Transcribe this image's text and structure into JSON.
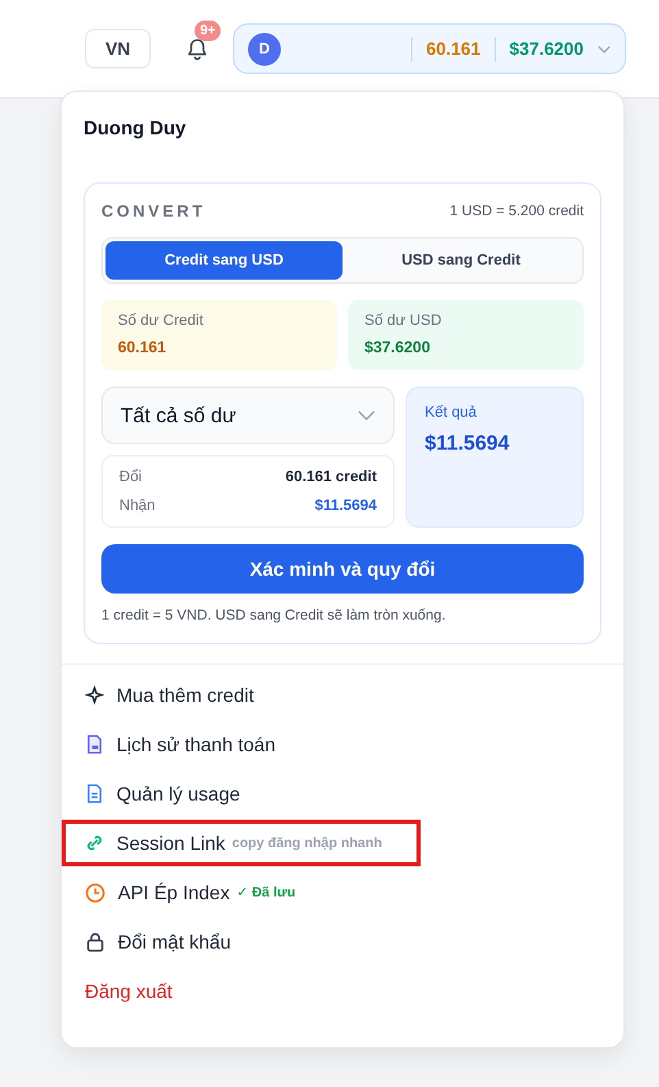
{
  "header": {
    "language": "VN",
    "notifications_badge": "9+",
    "account": {
      "avatar": "D",
      "credit": "60.161",
      "usd": "$37.6200"
    }
  },
  "profile": {
    "name": "Duong Duy"
  },
  "convert": {
    "title": "CONVERT",
    "rate": "1 USD = 5.200 credit",
    "modes": [
      {
        "label": "Credit sang USD",
        "selected": true
      },
      {
        "label": "USD sang Credit",
        "selected": false
      }
    ],
    "balances": [
      {
        "label": "Số dư Credit",
        "value": "60.161",
        "kind": "credit"
      },
      {
        "label": "Số dư USD",
        "value": "$37.6200",
        "kind": "usd"
      }
    ],
    "amount_select": "Tất cả số dư",
    "summary": [
      {
        "label": "Đổi",
        "value": "60.161 credit",
        "kind": "plain"
      },
      {
        "label": "Nhận",
        "value": "$11.5694",
        "kind": "accent"
      }
    ],
    "result": {
      "label": "Kết quả",
      "value": "$11.5694"
    },
    "submit": "Xác minh và quy đổi",
    "footnote": "1 credit = 5 VND. USD sang Credit sẽ làm tròn xuống."
  },
  "menu": [
    {
      "label": "Mua thêm credit",
      "kind": "sparkle",
      "highlighted": false
    },
    {
      "label": "Lịch sử thanh toán",
      "kind": "receipt",
      "highlighted": false
    },
    {
      "label": "Quản lý usage",
      "kind": "document",
      "highlighted": false
    },
    {
      "label": "Session Link",
      "kind": "link",
      "note": {
        "text": "copy đăng nhập nhanh",
        "kind": "hint"
      },
      "highlighted": true
    },
    {
      "label": "API Ép Index",
      "kind": "clock",
      "note": {
        "text": "✓ Đã lưu",
        "kind": "saved"
      },
      "highlighted": false
    },
    {
      "label": "Đổi mật khẩu",
      "kind": "lock",
      "highlighted": false
    },
    {
      "label": "Đăng xuất",
      "kind": "logout",
      "highlighted": false
    }
  ]
}
